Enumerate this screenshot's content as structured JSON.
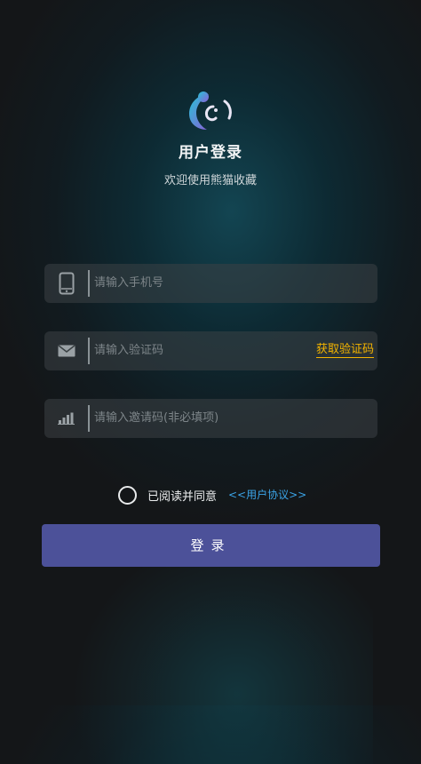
{
  "header": {
    "title": "用户登录",
    "subtitle": "欢迎使用熊猫收藏"
  },
  "form": {
    "phone": {
      "placeholder": "请输入手机号",
      "icon": "phone-icon"
    },
    "code": {
      "placeholder": "请输入验证码",
      "icon": "mail-icon",
      "get_code_label": "获取验证码"
    },
    "invite": {
      "placeholder": "请输入邀请码(非必填项)",
      "icon": "signal-bars-icon"
    }
  },
  "agreement": {
    "text": "已阅读并同意",
    "link": "<<用户协议>>",
    "checked": false
  },
  "login_button": {
    "label": "登录"
  },
  "colors": {
    "accent": "#4c5199",
    "link": "#3ba3e6",
    "get_code": "#f4b400"
  }
}
